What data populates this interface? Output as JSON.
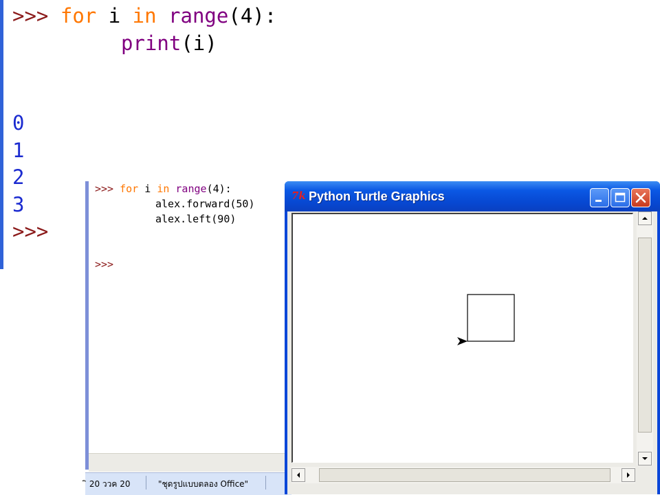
{
  "top_shell": {
    "prompt": ">>>",
    "code_kw_for": "for",
    "code_var": "i",
    "code_kw_in": "in",
    "code_range": "range",
    "code_range_args": "(4):",
    "code_print": "print",
    "code_print_args": "(i)",
    "outputs": [
      "0",
      "1",
      "2",
      "3"
    ],
    "final_prompt": ">>>"
  },
  "idle2": {
    "prompt": ">>>",
    "kw_for": "for",
    "var": "i",
    "kw_in": "in",
    "range": "range",
    "range_args": "(4):",
    "line2": "alex.forward(50)",
    "line3": "alex.left(90)",
    "prompt2": ">>>"
  },
  "taskbar": {
    "item1": "ิ 20 ววค 20",
    "item2": "\"ชุดรูปแบบตลอง Office\""
  },
  "turtle_window": {
    "title": "Python Turtle Graphics",
    "icon_label": "7k",
    "icon": "tk-feather-icon",
    "min_icon": "minimize-icon",
    "max_icon": "maximize-icon",
    "close_icon": "close-icon"
  },
  "colors": {
    "prompt": "#8b1a1a",
    "keyword": "#ff7700",
    "builtin": "#800080",
    "output": "#1b2bd0",
    "titlebar": "#0748d2"
  }
}
